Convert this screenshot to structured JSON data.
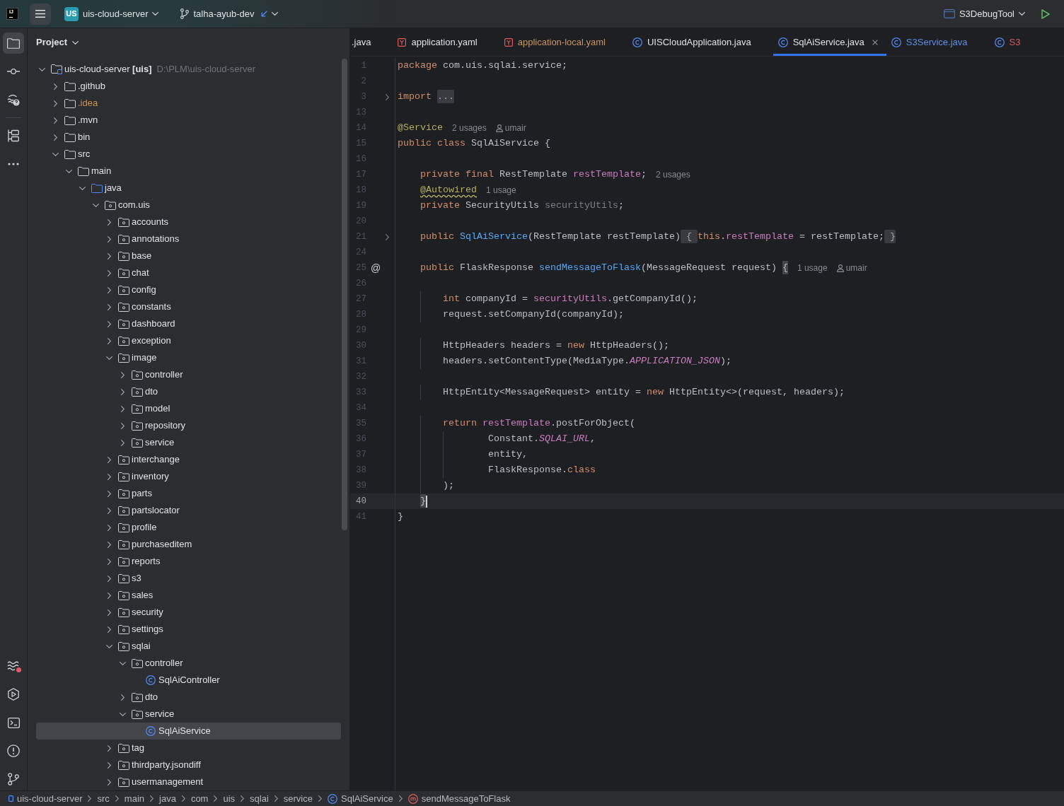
{
  "title_bar": {
    "logo": "IJ",
    "project_badge": "US",
    "project_name": "uis-cloud-server",
    "branch": "talha-ayub-dev",
    "run_configuration": "S3DebugTool"
  },
  "tool_strip": {
    "top": [
      {
        "selected": true
      },
      {
        "selected": false
      },
      {
        "selected": false
      },
      {
        "selected": false
      },
      {
        "selected": false
      }
    ],
    "bottom": [
      {
        "selected": false,
        "alert": true
      },
      {
        "selected": false,
        "alert": false
      },
      {
        "selected": false,
        "alert": false
      },
      {
        "selected": false,
        "alert": false
      },
      {
        "selected": false,
        "alert": false
      }
    ]
  },
  "project_panel": {
    "title": "Project",
    "tree": [
      {
        "name": "uis-cloud-server **[uis]**",
        "path": "D:\\PLM\\uis-cloud-server",
        "kind": "module",
        "expanded": true,
        "selected": false,
        "children": [
          {
            "name": ".github",
            "kind": "folder",
            "expanded": false,
            "selected": false
          },
          {
            "name": ".idea",
            "kind": "folder",
            "expanded": false,
            "selected": false,
            "color": "#c7955e"
          },
          {
            "name": ".mvn",
            "kind": "folder",
            "expanded": false,
            "selected": false
          },
          {
            "name": "bin",
            "kind": "folder",
            "expanded": false,
            "selected": false
          },
          {
            "name": "src",
            "kind": "folder",
            "expanded": true,
            "selected": false,
            "children": [
              {
                "name": "main",
                "kind": "folder",
                "expanded": true,
                "selected": false,
                "children": [
                  {
                    "name": "java",
                    "kind": "source_root",
                    "expanded": true,
                    "selected": false,
                    "children": [
                      {
                        "name": "com.uis",
                        "kind": "package",
                        "expanded": true,
                        "selected": false,
                        "children": [
                          {
                            "name": "accounts",
                            "kind": "package",
                            "expanded": false,
                            "selected": false
                          },
                          {
                            "name": "annotations",
                            "kind": "package",
                            "expanded": false,
                            "selected": false
                          },
                          {
                            "name": "base",
                            "kind": "package",
                            "expanded": false,
                            "selected": false
                          },
                          {
                            "name": "chat",
                            "kind": "package",
                            "expanded": false,
                            "selected": false
                          },
                          {
                            "name": "config",
                            "kind": "package",
                            "expanded": false,
                            "selected": false
                          },
                          {
                            "name": "constants",
                            "kind": "package",
                            "expanded": false,
                            "selected": false
                          },
                          {
                            "name": "dashboard",
                            "kind": "package",
                            "expanded": false,
                            "selected": false
                          },
                          {
                            "name": "exception",
                            "kind": "package",
                            "expanded": false,
                            "selected": false
                          },
                          {
                            "name": "image",
                            "kind": "package",
                            "expanded": true,
                            "selected": false,
                            "children": [
                              {
                                "name": "controller",
                                "kind": "package",
                                "expanded": false,
                                "selected": false
                              },
                              {
                                "name": "dto",
                                "kind": "package",
                                "expanded": false,
                                "selected": false
                              },
                              {
                                "name": "model",
                                "kind": "package",
                                "expanded": false,
                                "selected": false
                              },
                              {
                                "name": "repository",
                                "kind": "package",
                                "expanded": false,
                                "selected": false
                              },
                              {
                                "name": "service",
                                "kind": "package",
                                "expanded": false,
                                "selected": false
                              }
                            ]
                          },
                          {
                            "name": "interchange",
                            "kind": "package",
                            "expanded": false,
                            "selected": false
                          },
                          {
                            "name": "inventory",
                            "kind": "package",
                            "expanded": false,
                            "selected": false
                          },
                          {
                            "name": "parts",
                            "kind": "package",
                            "expanded": false,
                            "selected": false
                          },
                          {
                            "name": "partslocator",
                            "kind": "package",
                            "expanded": false,
                            "selected": false
                          },
                          {
                            "name": "profile",
                            "kind": "package",
                            "expanded": false,
                            "selected": false
                          },
                          {
                            "name": "purchaseditem",
                            "kind": "package",
                            "expanded": false,
                            "selected": false
                          },
                          {
                            "name": "reports",
                            "kind": "package",
                            "expanded": false,
                            "selected": false
                          },
                          {
                            "name": "s3",
                            "kind": "package",
                            "expanded": false,
                            "selected": false
                          },
                          {
                            "name": "sales",
                            "kind": "package",
                            "expanded": false,
                            "selected": false
                          },
                          {
                            "name": "security",
                            "kind": "package",
                            "expanded": false,
                            "selected": false
                          },
                          {
                            "name": "settings",
                            "kind": "package",
                            "expanded": false,
                            "selected": false
                          },
                          {
                            "name": "sqlai",
                            "kind": "package",
                            "expanded": true,
                            "selected": false,
                            "children": [
                              {
                                "name": "controller",
                                "kind": "package",
                                "expanded": true,
                                "selected": false,
                                "children": [
                                  {
                                    "name": "SqlAiController",
                                    "kind": "class",
                                    "selected": false
                                  }
                                ]
                              },
                              {
                                "name": "dto",
                                "kind": "package",
                                "expanded": false,
                                "selected": false
                              },
                              {
                                "name": "service",
                                "kind": "package",
                                "expanded": true,
                                "selected": false,
                                "children": [
                                  {
                                    "name": "SqlAiService",
                                    "kind": "class",
                                    "selected": true
                                  }
                                ]
                              }
                            ]
                          },
                          {
                            "name": "tag",
                            "kind": "package",
                            "expanded": false,
                            "selected": false
                          },
                          {
                            "name": "thirdparty.jsondiff",
                            "kind": "package",
                            "expanded": false,
                            "selected": false
                          },
                          {
                            "name": "usermanagement",
                            "kind": "package",
                            "expanded": false,
                            "selected": false
                          }
                        ]
                      }
                    ]
                  }
                ]
              }
            ]
          }
        ]
      }
    ]
  },
  "editor": {
    "tabs": [
      {
        "label": ".java",
        "selected": false,
        "color": "#dfe1e5"
      },
      {
        "label": "application.yaml",
        "kind": "yaml",
        "selected": false,
        "color": "#dfe1e5"
      },
      {
        "label": "application-local.yaml",
        "kind": "yaml",
        "selected": false,
        "color": "#c7955e"
      },
      {
        "label": "UISCloudApplication.java",
        "kind": "class",
        "selected": false,
        "color": "#dfe1e5"
      },
      {
        "label": "SqlAiService.java",
        "kind": "class",
        "selected": true,
        "color": "#dfe1e5"
      },
      {
        "label": "S3Service.java",
        "kind": "class",
        "selected": false,
        "color": "#5e8ee8"
      },
      {
        "label": "S3",
        "kind": "class",
        "selected": false,
        "color": "#d65c5c"
      }
    ],
    "lines": [
      {
        "number": "1",
        "folded": false,
        "current": false,
        "tokens": [
          {
            "text": "package",
            "kind": "keyword"
          },
          {
            "text": " com.uis.sqlai.service;",
            "kind": "plain"
          }
        ]
      },
      {
        "number": "2",
        "folded": false,
        "current": false
      },
      {
        "number": "3",
        "folded": true,
        "current": false,
        "tokens": [
          {
            "text": "import ",
            "kind": "keyword"
          },
          {
            "text": "...",
            "kind": "folded"
          }
        ]
      },
      {
        "number": "13",
        "folded": false,
        "current": false
      },
      {
        "number": "14",
        "folded": false,
        "current": false,
        "tokens": [
          {
            "text": "@Service",
            "kind": "annotation"
          }
        ],
        "hints": [
          {
            "kind": "usages",
            "text": "2 usages"
          },
          {
            "kind": "author",
            "text": "umair"
          }
        ]
      },
      {
        "number": "15",
        "folded": false,
        "current": false,
        "tokens": [
          {
            "text": "public class ",
            "kind": "keyword"
          },
          {
            "text": "SqlAiService {",
            "kind": "plain"
          }
        ]
      },
      {
        "number": "16",
        "folded": false,
        "current": false
      },
      {
        "number": "17",
        "folded": false,
        "current": false,
        "tokens": [
          {
            "text": "    private final ",
            "kind": "keyword"
          },
          {
            "text": "RestTemplate ",
            "kind": "plain"
          },
          {
            "text": "restTemplate",
            "kind": "field"
          },
          {
            "text": ";",
            "kind": "plain"
          }
        ],
        "hints": [
          {
            "kind": "usages",
            "text": "2 usages"
          }
        ]
      },
      {
        "number": "18",
        "folded": false,
        "current": false,
        "tokens": [
          {
            "text": "    @Autowired",
            "kind": "annotation",
            "warning": true
          }
        ],
        "hints": [
          {
            "kind": "usages",
            "text": "1 usage"
          }
        ]
      },
      {
        "number": "19",
        "folded": false,
        "current": false,
        "tokens": [
          {
            "text": "    private ",
            "kind": "keyword"
          },
          {
            "text": "SecurityUtils ",
            "kind": "plain"
          },
          {
            "text": "securityUtils",
            "kind": "unused"
          },
          {
            "text": ";",
            "kind": "plain"
          }
        ]
      },
      {
        "number": "20",
        "folded": false,
        "current": false
      },
      {
        "number": "21",
        "folded": true,
        "current": false,
        "tokens": [
          {
            "text": "    public ",
            "kind": "keyword"
          },
          {
            "text": "SqlAiService",
            "kind": "method"
          },
          {
            "text": "(RestTemplate restTemplate)",
            "kind": "plain"
          },
          {
            "text": " { ",
            "kind": "folded"
          },
          {
            "text": "this",
            "kind": "keyword"
          },
          {
            "text": ".",
            "kind": "plain"
          },
          {
            "text": "restTemplate",
            "kind": "field"
          },
          {
            "text": " = restTemplate;",
            "kind": "plain"
          },
          {
            "text": " }",
            "kind": "folded"
          }
        ]
      },
      {
        "number": "24",
        "folded": false,
        "current": false
      },
      {
        "number": "25",
        "folded": false,
        "current": false,
        "gutter_mark": "@",
        "tokens": [
          {
            "text": "    public ",
            "kind": "keyword"
          },
          {
            "text": "FlaskResponse ",
            "kind": "plain"
          },
          {
            "text": "sendMessageToFlask",
            "kind": "method"
          },
          {
            "text": "(MessageRequest request) ",
            "kind": "plain"
          },
          {
            "text": "{",
            "kind": "match"
          }
        ],
        "hints": [
          {
            "kind": "usages",
            "text": "1 usage"
          },
          {
            "kind": "author",
            "text": "umair"
          }
        ]
      },
      {
        "number": "26",
        "folded": false,
        "current": false
      },
      {
        "number": "27",
        "folded": false,
        "current": false,
        "tokens": [
          {
            "text": "        int ",
            "kind": "keyword"
          },
          {
            "text": "companyId = ",
            "kind": "plain"
          },
          {
            "text": "securityUtils",
            "kind": "field"
          },
          {
            "text": ".getCompanyId();",
            "kind": "plain"
          }
        ]
      },
      {
        "number": "28",
        "folded": false,
        "current": false,
        "tokens": [
          {
            "text": "        request.setCompanyId(companyId);",
            "kind": "plain"
          }
        ]
      },
      {
        "number": "29",
        "folded": false,
        "current": false
      },
      {
        "number": "30",
        "folded": false,
        "current": false,
        "tokens": [
          {
            "text": "        HttpHeaders headers = ",
            "kind": "plain"
          },
          {
            "text": "new ",
            "kind": "keyword"
          },
          {
            "text": "HttpHeaders();",
            "kind": "plain"
          }
        ]
      },
      {
        "number": "31",
        "folded": false,
        "current": false,
        "tokens": [
          {
            "text": "        headers.setContentType(MediaType.",
            "kind": "plain"
          },
          {
            "text": "APPLICATION_JSON",
            "kind": "constant"
          },
          {
            "text": ");",
            "kind": "plain"
          }
        ]
      },
      {
        "number": "32",
        "folded": false,
        "current": false
      },
      {
        "number": "33",
        "folded": false,
        "current": false,
        "tokens": [
          {
            "text": "        HttpEntity<MessageRequest> entity = ",
            "kind": "plain"
          },
          {
            "text": "new ",
            "kind": "keyword"
          },
          {
            "text": "HttpEntity<>(request, headers);",
            "kind": "plain"
          }
        ]
      },
      {
        "number": "34",
        "folded": false,
        "current": false
      },
      {
        "number": "35",
        "folded": false,
        "current": false,
        "tokens": [
          {
            "text": "        return ",
            "kind": "keyword"
          },
          {
            "text": "restTemplate",
            "kind": "field"
          },
          {
            "text": ".postForObject(",
            "kind": "plain"
          }
        ]
      },
      {
        "number": "36",
        "folded": false,
        "current": false,
        "tokens": [
          {
            "text": "                Constant.",
            "kind": "plain"
          },
          {
            "text": "SQLAI_URL",
            "kind": "constant"
          },
          {
            "text": ",",
            "kind": "plain"
          }
        ]
      },
      {
        "number": "37",
        "folded": false,
        "current": false,
        "tokens": [
          {
            "text": "                entity,",
            "kind": "plain"
          }
        ]
      },
      {
        "number": "38",
        "folded": false,
        "current": false,
        "tokens": [
          {
            "text": "                FlaskResponse.",
            "kind": "plain"
          },
          {
            "text": "class",
            "kind": "keyword"
          }
        ]
      },
      {
        "number": "39",
        "folded": false,
        "current": false,
        "tokens": [
          {
            "text": "        );",
            "kind": "plain"
          }
        ]
      },
      {
        "number": "40",
        "folded": false,
        "current": true,
        "tokens": [
          {
            "text": "    }",
            "kind": "match"
          }
        ]
      },
      {
        "number": "41",
        "folded": false,
        "current": false,
        "tokens": [
          {
            "text": "}",
            "kind": "plain"
          }
        ]
      }
    ]
  },
  "breadcrumbs": [
    {
      "label": "uis-cloud-server",
      "kind": "module"
    },
    {
      "label": "src",
      "kind": "path"
    },
    {
      "label": "main",
      "kind": "path"
    },
    {
      "label": "java",
      "kind": "path"
    },
    {
      "label": "com",
      "kind": "path"
    },
    {
      "label": "uis",
      "kind": "path"
    },
    {
      "label": "sqlai",
      "kind": "path"
    },
    {
      "label": "service",
      "kind": "path"
    },
    {
      "label": "SqlAiService",
      "kind": "class"
    },
    {
      "label": "sendMessageToFlask",
      "kind": "method"
    }
  ]
}
